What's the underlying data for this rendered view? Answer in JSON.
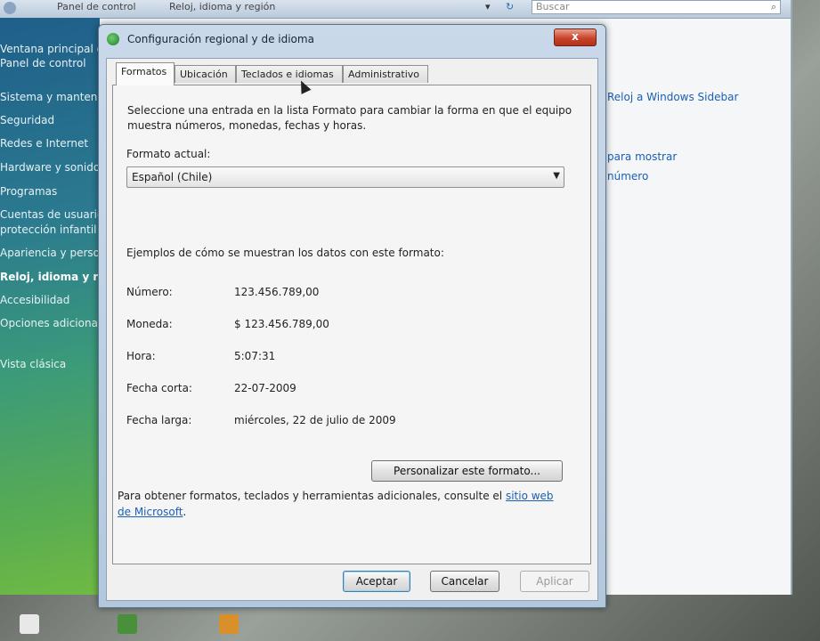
{
  "background_window": {
    "breadcrumb": [
      "Panel de control",
      "Reloj, idioma y región"
    ],
    "search_placeholder": "Buscar",
    "sidebar_items": [
      "Ventana principal del",
      "Panel de control",
      "Sistema y mantenimiento",
      "Seguridad",
      "Redes e Internet",
      "Hardware y sonido",
      "Programas",
      "Cuentas de usuario y",
      "protección infantil",
      "Apariencia y personalización",
      "Reloj, idioma y región",
      "Accesibilidad",
      "Opciones adicionales",
      "Vista clásica"
    ],
    "content_links": [
      "Reloj a Windows Sidebar",
      "para mostrar",
      "número"
    ]
  },
  "dialog": {
    "title": "Configuración regional y de idioma",
    "close_label": "x",
    "tabs": [
      {
        "label": "Formatos",
        "selected": true
      },
      {
        "label": "Ubicación",
        "selected": false
      },
      {
        "label": "Teclados e idiomas",
        "selected": false
      },
      {
        "label": "Administrativo",
        "selected": false
      }
    ],
    "description": "Seleccione una entrada en la lista Formato para cambiar la forma en que el equipo muestra números, monedas, fechas y horas.",
    "current_format_label": "Formato actual:",
    "current_format_value": "Español (Chile)",
    "examples_heading": "Ejemplos de cómo se muestran los datos con este formato:",
    "examples": [
      {
        "label": "Número:",
        "value": "123.456.789,00"
      },
      {
        "label": "Moneda:",
        "value": "$ 123.456.789,00"
      },
      {
        "label": "Hora:",
        "value": "5:07:31"
      },
      {
        "label": "Fecha corta:",
        "value": "22-07-2009"
      },
      {
        "label": "Fecha larga:",
        "value": "miércoles, 22 de julio de 2009"
      }
    ],
    "customize_button": "Personalizar este formato...",
    "footer_text": "Para obtener formatos, teclados y herramientas adicionales, consulte el ",
    "footer_link": "sitio web de Microsoft",
    "footer_end": ".",
    "ok_button": "Aceptar",
    "cancel_button": "Cancelar",
    "apply_button": "Aplicar"
  }
}
